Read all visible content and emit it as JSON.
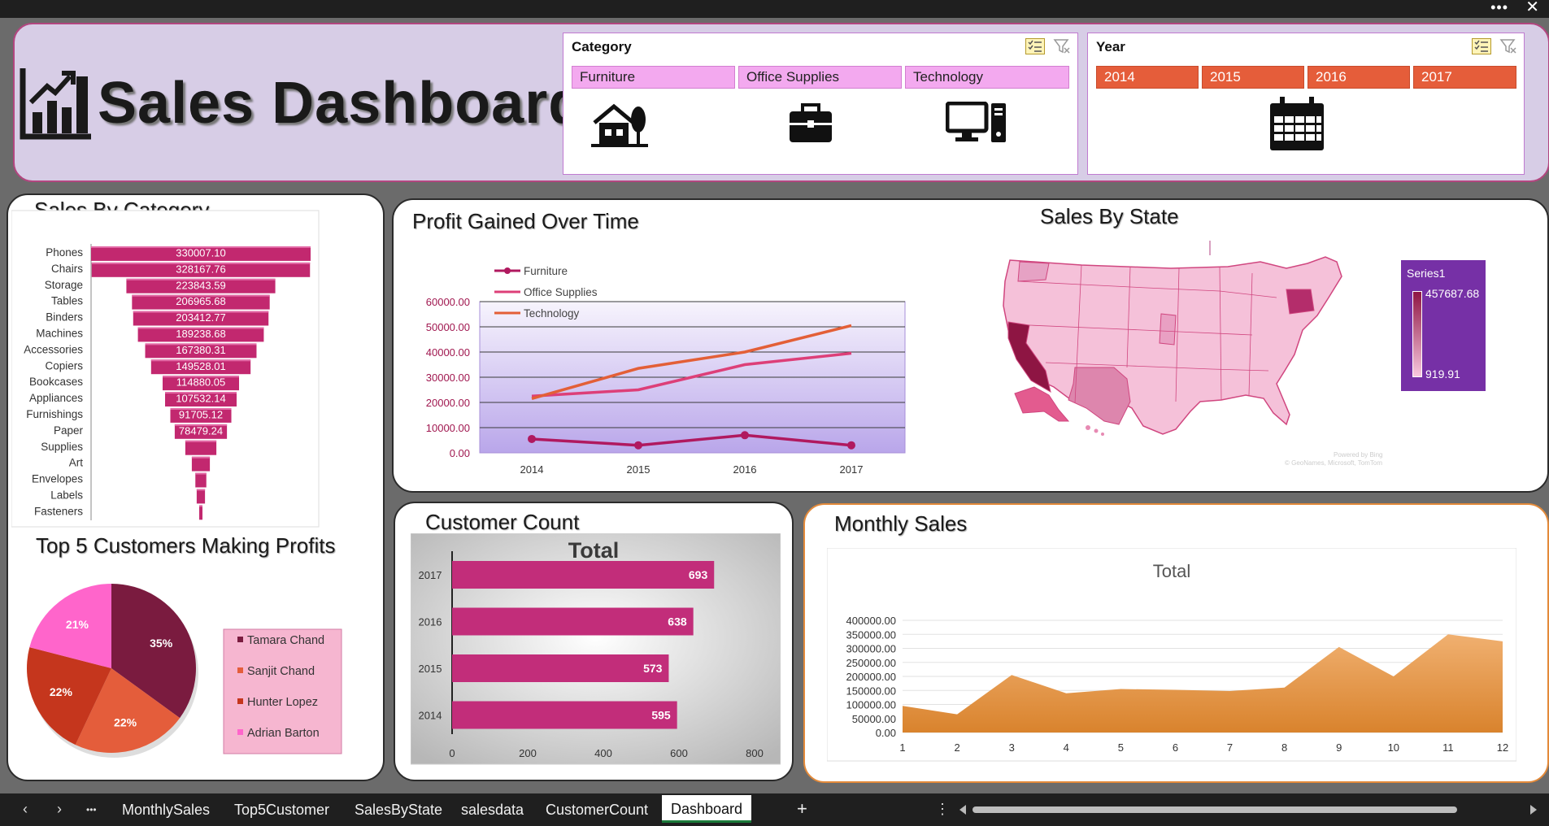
{
  "title": "Sales Dashboard",
  "category_slicer": {
    "title": "Category",
    "items": [
      "Furniture",
      "Office Supplies",
      "Technology"
    ]
  },
  "year_slicer": {
    "title": "Year",
    "items": [
      "2014",
      "2015",
      "2016",
      "2017"
    ]
  },
  "panels": {
    "sales_by_category": "Sales By Category",
    "profit_over_time": "Profit Gained Over Time",
    "sales_by_state": "Sales By State",
    "top5": "Top 5 Customers Making Profits",
    "customer_count": "Customer Count",
    "monthly_sales": "Monthly Sales"
  },
  "chart_data": [
    {
      "id": "sales_by_category",
      "type": "bar",
      "orientation": "horizontal-funnel",
      "title": "Sales By Category",
      "categories": [
        "Phones",
        "Chairs",
        "Storage",
        "Tables",
        "Binders",
        "Machines",
        "Accessories",
        "Copiers",
        "Bookcases",
        "Appliances",
        "Furnishings",
        "Paper",
        "Supplies",
        "Art",
        "Envelopes",
        "Labels",
        "Fasteners"
      ],
      "values": [
        330007.1,
        328167.76,
        223843.59,
        206965.68,
        203412.77,
        189238.68,
        167380.31,
        149528.01,
        114880.05,
        107532.14,
        91705.12,
        78479.24,
        46673.54,
        27118.79,
        16476.4,
        12486.31,
        3024.28
      ],
      "value_labels": [
        "330007.10",
        "328167.76",
        "223843.59",
        "206965.68",
        "203412.77",
        "189238.68",
        "167380.31",
        "149528.01",
        "114880.05",
        "107532.14",
        "91705.12",
        "78479.24",
        "",
        "",
        "",
        "",
        ""
      ],
      "color": "#c2286f"
    },
    {
      "id": "profit_over_time",
      "type": "line",
      "title": "Profit Gained Over Time",
      "x": [
        "2014",
        "2015",
        "2016",
        "2017"
      ],
      "ylim": [
        0,
        60000
      ],
      "yticks": [
        "0.00",
        "10000.00",
        "20000.00",
        "30000.00",
        "40000.00",
        "50000.00",
        "60000.00"
      ],
      "legend": "top-left",
      "series": [
        {
          "name": "Furniture",
          "values": [
            5500,
            3000,
            7000,
            3000
          ],
          "color": "#b0195f"
        },
        {
          "name": "Office Supplies",
          "values": [
            22500,
            25000,
            35000,
            39500
          ],
          "color": "#dd3f78"
        },
        {
          "name": "Technology",
          "values": [
            21500,
            33500,
            40000,
            50500
          ],
          "color": "#e35f37"
        }
      ]
    },
    {
      "id": "sales_by_state",
      "type": "map",
      "title": "Sales By State",
      "legend_title": "Series1",
      "max": "457687.68",
      "min": "919.91",
      "attribution": [
        "Powered by Bing",
        "© GeoNames, Microsoft, TomTom"
      ]
    },
    {
      "id": "top5",
      "type": "pie",
      "title": "Top 5 Customers Making Profits",
      "labels": [
        "Tamara Chand",
        "Sanjit Chand",
        "Hunter Lopez",
        "Adrian Barton"
      ],
      "values": [
        35,
        22,
        22,
        21
      ],
      "value_labels": [
        "35%",
        "22%",
        "22%",
        "21%"
      ],
      "colors": [
        "#7a1b3f",
        "#e45d3b",
        "#c5361d",
        "#ff65cb"
      ]
    },
    {
      "id": "customer_count",
      "type": "bar",
      "orientation": "horizontal",
      "title": "Total",
      "categories": [
        "2017",
        "2016",
        "2015",
        "2014"
      ],
      "values": [
        693,
        638,
        573,
        595
      ],
      "xlim": [
        0,
        800
      ],
      "xticks": [
        "0",
        "200",
        "400",
        "600",
        "800"
      ],
      "color": "#c22d7a"
    },
    {
      "id": "monthly_sales",
      "type": "area",
      "title": "Total",
      "x": [
        "1",
        "2",
        "3",
        "4",
        "5",
        "6",
        "7",
        "8",
        "9",
        "10",
        "11",
        "12"
      ],
      "values": [
        95000,
        65000,
        205000,
        140000,
        155000,
        152000,
        148000,
        160000,
        305000,
        200000,
        350000,
        325000
      ],
      "ylim": [
        0,
        400000
      ],
      "yticks": [
        "0.00",
        "50000.00",
        "100000.00",
        "150000.00",
        "200000.00",
        "250000.00",
        "300000.00",
        "350000.00",
        "400000.00"
      ],
      "color": "#e0913c"
    }
  ],
  "sheet_tabs": [
    "MonthlySales",
    "Top5Customer",
    "SalesByState",
    "salesdata",
    "CustomerCount",
    "Dashboard"
  ],
  "active_tab": "Dashboard",
  "add_sheet": "+",
  "nav": {
    "prev": "‹",
    "next": "›",
    "more": "•••",
    "options": "⋮"
  }
}
